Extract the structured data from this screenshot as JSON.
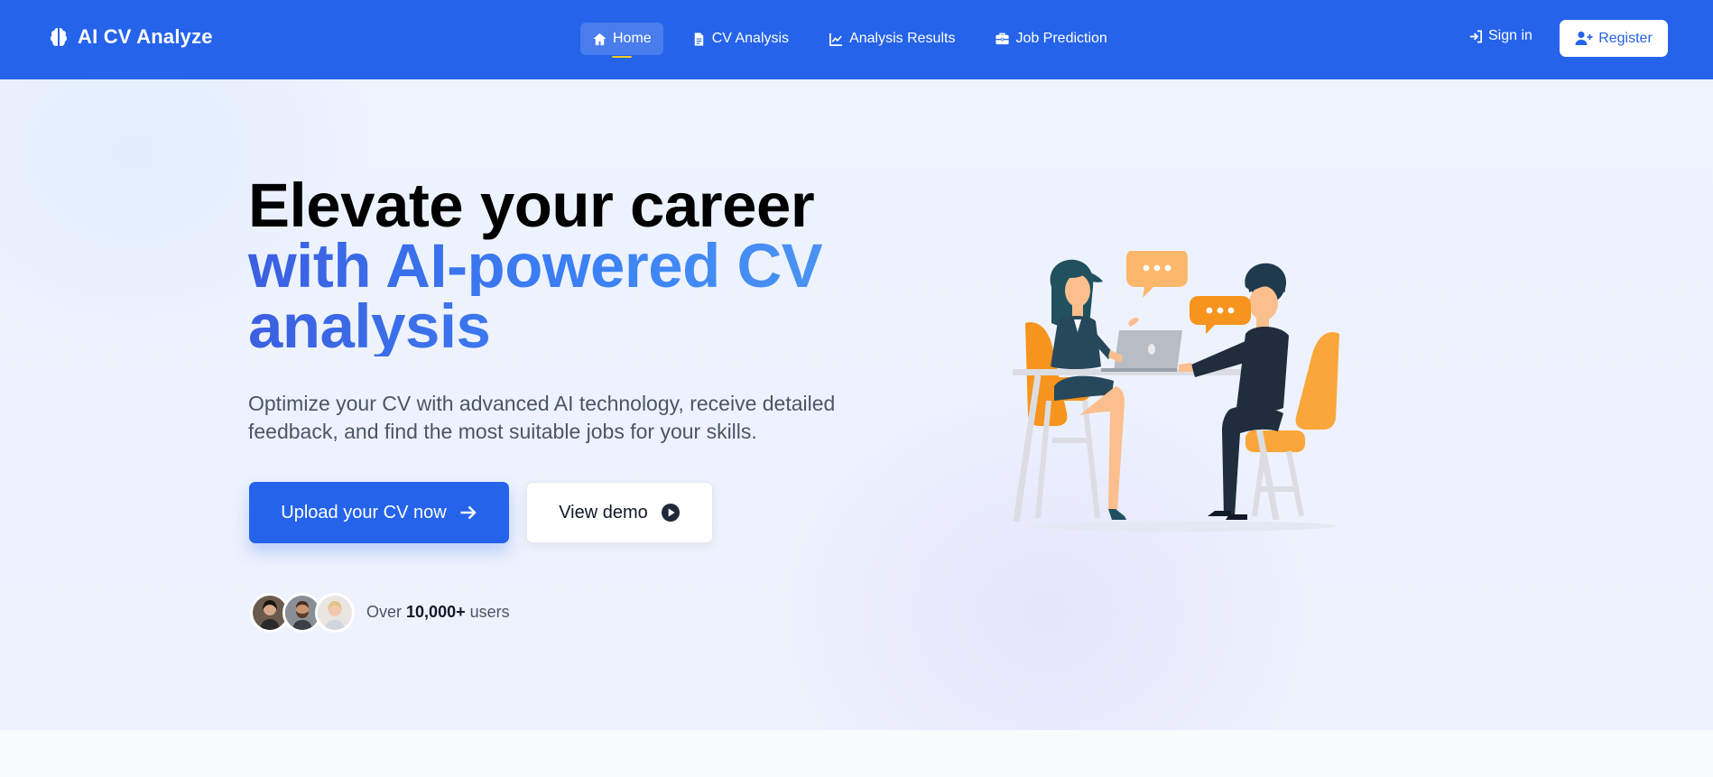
{
  "brand": {
    "name": "AI CV Analyze",
    "icon": "brain-icon"
  },
  "nav": {
    "items": [
      {
        "label": "Home",
        "icon": "home-icon",
        "active": true
      },
      {
        "label": "CV Analysis",
        "icon": "file-icon",
        "active": false
      },
      {
        "label": "Analysis Results",
        "icon": "chart-line-icon",
        "active": false
      },
      {
        "label": "Job Prediction",
        "icon": "briefcase-icon",
        "active": false
      }
    ],
    "signin_label": "Sign in",
    "register_label": "Register"
  },
  "hero": {
    "headline_line1": "Elevate your career",
    "headline_line2": "with AI-powered CV",
    "headline_line3": "analysis",
    "subtext": "Optimize your CV with advanced AI technology, receive detailed feedback, and find the most suitable jobs for your skills.",
    "primary_button": "Upload your CV now",
    "secondary_button": "View demo",
    "users_prefix": "Over",
    "users_count": "10,000+",
    "users_suffix": "users"
  },
  "colors": {
    "primary": "#2563eb",
    "accent_underline": "#facc15",
    "illustration_orange": "#f7941d",
    "illustration_navy": "#1f2d3d"
  }
}
